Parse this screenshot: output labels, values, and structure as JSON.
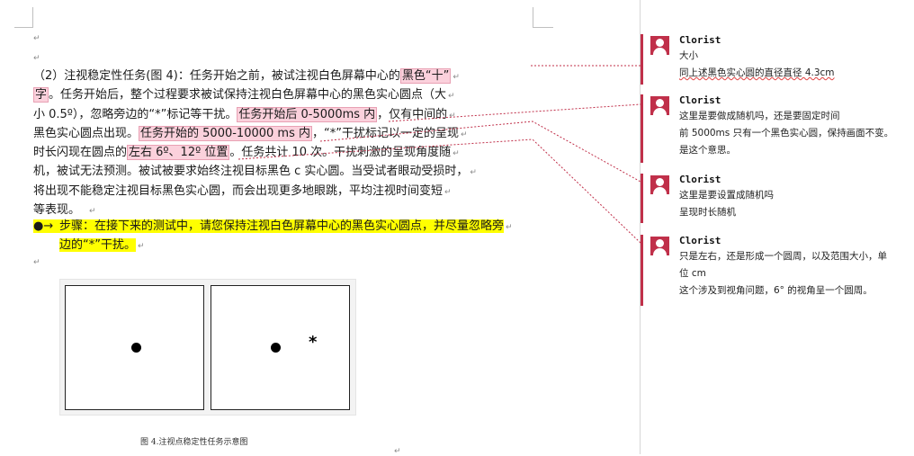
{
  "document": {
    "para_marks": {
      "top1": "↵",
      "top2": "↵",
      "blank": "↵",
      "bottom": "↵"
    },
    "paragraph": {
      "line1_a": "（2）注视稳定性任务(图 4)：任务开始之前，被试注视白色屏幕中心的",
      "line1_c": "黑色“十”",
      "line2_c": "字",
      "line2_b": "。任务开始后，整个过程要求被试保持注视白色屏幕中心的黑色实心圆点（大",
      "line3_a": "小 0.5º），忽略旁边的“*”标记等干扰。",
      "line3_c": "任务开始后 0-5000ms 内",
      "line3_b": "，仅有中间的",
      "line4_a": "黑色实心圆点出现。",
      "line4_c": "任务开始的 5000-10000 ms 内",
      "line4_b": "，“*”干扰标记以一定的呈现",
      "line5_a": "时长闪现在圆点的",
      "line5_c": "左右 6º、12º 位置",
      "line5_b": "。任务共计 10 次。干扰刺激的呈现角度随",
      "line6": "机，被试无法预测。被试被要求始终注视目标黑色 c 实心圆。当受试者眼动受损时，",
      "line7": "将出现不能稳定注视目标黑色实心圆，而会出现更多地眼跳，平均注视时间变短",
      "line8": "等表现。"
    },
    "bullet": {
      "symbol": "●→",
      "line1": "步骤：在接下来的测试中，请您保持注视白色屏幕中心的黑色实心圆点，并尽量忽略旁",
      "line2": "边的“*”干扰。"
    },
    "figure": {
      "star": "*"
    },
    "caption": "图 4.注视点稳定性任务示意图"
  },
  "comments": [
    {
      "author": "Clorist",
      "lines": [
        "大小",
        "同上述黑色实心圆的直径直径 4.3cm"
      ]
    },
    {
      "author": "Clorist",
      "lines": [
        "这里是要做成随机吗，还是要固定时间",
        "前 5000ms 只有一个黑色实心圆，保持画面不变。",
        "是这个意思。"
      ]
    },
    {
      "author": "Clorist",
      "lines": [
        "这里是要设置成随机吗",
        "呈现时长随机"
      ]
    },
    {
      "author": "Clorist",
      "lines": [
        "只是左右，还是形成一个圆周，以及范围大小，单",
        "位 cm",
        "这个涉及到视角问题，6° 的视角呈一个圆周。"
      ]
    }
  ],
  "colors": {
    "comment_accent": "#c0304a",
    "comment_highlight": "#fbd1dc",
    "text_highlight": "#ffff00"
  }
}
